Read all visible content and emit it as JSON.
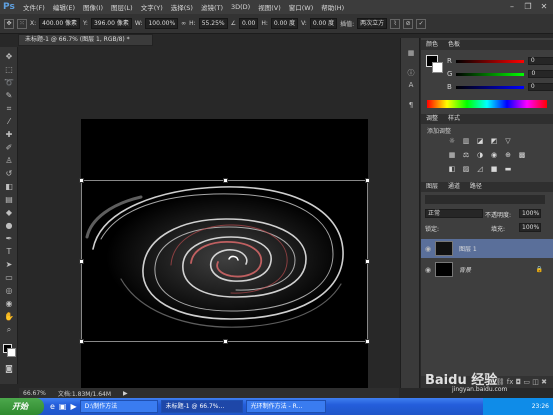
{
  "app": {
    "logo": "Ps"
  },
  "menu": [
    "文件(F)",
    "编辑(E)",
    "图像(I)",
    "图层(L)",
    "文字(Y)",
    "选择(S)",
    "滤镜(T)",
    "3D(D)",
    "视图(V)",
    "窗口(W)",
    "帮助(H)"
  ],
  "window_controls": {
    "minimize": "–",
    "restore": "❐",
    "close": "✕"
  },
  "options": {
    "x_label": "X:",
    "x_value": "400.00 像素",
    "y_label": "Y:",
    "y_value": "396.00 像素",
    "w_label": "W:",
    "w_value": "100.00%",
    "h_label": "H:",
    "h_value": "55.25%",
    "angle_value": "0.00",
    "hskew_label": "H:",
    "hskew_value": "0.00 度",
    "vskew_label": "V:",
    "vskew_value": "0.00 度",
    "interp_label": "插值:",
    "interp_value": "两次立方"
  },
  "document": {
    "tab_title": "未标题-1 @ 66.7% (图层 1, RGB/8) *",
    "zoom": "66.67%",
    "doc_size": "文档:1.83M/1.64M"
  },
  "panels": {
    "color_tab": "颜色",
    "swatch_tab": "色板",
    "r_label": "R",
    "g_label": "G",
    "b_label": "B",
    "r_value": "0",
    "g_value": "0",
    "b_value": "0",
    "adjust_tab": "调整",
    "style_tab": "样式",
    "adjust_hint": "添加调整",
    "layers_tab": "图层",
    "channels_tab": "通道",
    "paths_tab": "路径",
    "blend_mode": "正常",
    "opacity_label": "不透明度:",
    "opacity_value": "100%",
    "lock_label": "锁定:",
    "fill_label": "填充:",
    "fill_value": "100%",
    "layers": [
      {
        "name": "图层 1",
        "selected": true
      },
      {
        "name": "背景",
        "selected": false
      }
    ]
  },
  "taskbar": {
    "start": "开始",
    "buttons": [
      "D:\\制作方法",
      "未标题-1 @ 66.7%...",
      "光环制作方法 - R..."
    ],
    "clock": "23:26"
  },
  "watermark": {
    "brand": "Baidu 经验",
    "url": "jingyan.baidu.com"
  },
  "colors": {
    "accent": "#245edb",
    "selected_layer": "#5a6f9a"
  }
}
